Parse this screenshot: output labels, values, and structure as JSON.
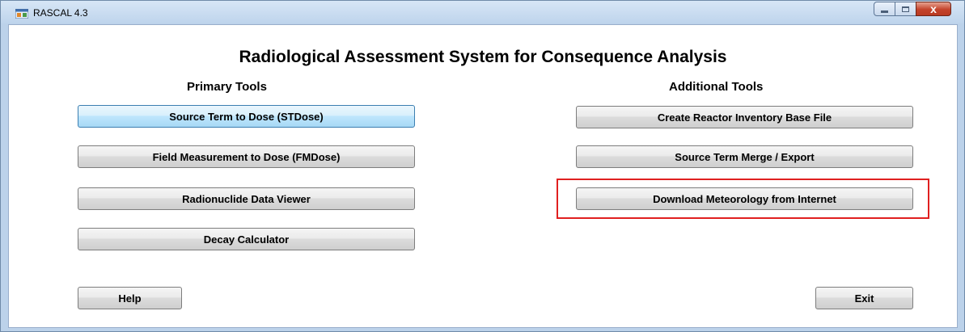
{
  "window": {
    "title": "RASCAL 4.3",
    "close_glyph": "x",
    "icon": "app-window-icon"
  },
  "main": {
    "heading": "Radiological Assessment System for Consequence Analysis",
    "primary_label": "Primary Tools",
    "additional_label": "Additional Tools"
  },
  "primary_tools": [
    "Source Term to Dose (STDose)",
    "Field Measurement to Dose (FMDose)",
    "Radionuclide Data Viewer",
    "Decay Calculator"
  ],
  "additional_tools": [
    "Create Reactor Inventory Base File",
    "Source Term Merge / Export",
    "Download Meteorology from Internet"
  ],
  "footer": {
    "help_label": "Help",
    "exit_label": "Exit"
  },
  "colors": {
    "highlight": "#e02020",
    "titlebar": "#bed4ec",
    "close_button": "#c4432b"
  }
}
